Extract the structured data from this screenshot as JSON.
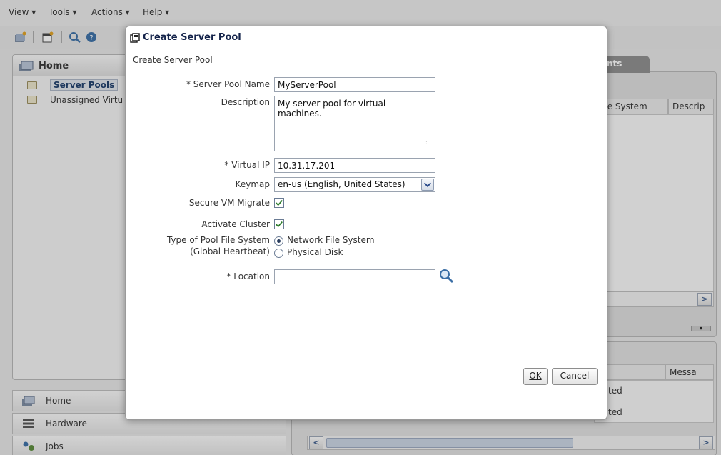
{
  "menubar": {
    "items": [
      {
        "label": "View",
        "accel": "V"
      },
      {
        "label": "Tools",
        "accel": "T"
      },
      {
        "label": "Actions",
        "accel": "A"
      },
      {
        "label": "Help",
        "accel": "H"
      }
    ]
  },
  "navigator": {
    "header": "Home",
    "items": [
      {
        "label": "Server Pools",
        "selected": true
      },
      {
        "label": "Unassigned Virtu",
        "selected": false
      }
    ]
  },
  "accordion": {
    "items": [
      {
        "label": "Home",
        "icon": "home-icon"
      },
      {
        "label": "Hardware",
        "icon": "hardware-icon"
      },
      {
        "label": "Jobs",
        "icon": "jobs-icon"
      }
    ]
  },
  "right_panel": {
    "tab_label": "nts",
    "columns": [
      "File System",
      "Descrip"
    ]
  },
  "jobs_panel": {
    "columns": [
      "Messa"
    ],
    "rows": [
      "ted",
      "ted"
    ]
  },
  "dialog": {
    "title": "Create Server Pool",
    "subtitle": "Create Server Pool",
    "fields": {
      "name": {
        "label": "Server Pool Name",
        "required": true,
        "value": "MyServerPool"
      },
      "description": {
        "label": "Description",
        "value": "My server pool for virtual\nmachines."
      },
      "virtual_ip": {
        "label": "Virtual IP",
        "required": true,
        "value": "10.31.17.201"
      },
      "keymap": {
        "label": "Keymap",
        "value": "en-us (English, United States)"
      },
      "secure_vm_migrate": {
        "label": "Secure VM Migrate",
        "checked": true
      },
      "activate_cluster": {
        "label": "Activate Cluster",
        "checked": true
      },
      "pool_fs_type": {
        "label_line1": "Type of Pool File System",
        "label_line2": "(Global Heartbeat)",
        "options": [
          {
            "label": "Network File System",
            "selected": true
          },
          {
            "label": "Physical Disk",
            "selected": false
          }
        ]
      },
      "location": {
        "label": "Location",
        "required": true,
        "value": ""
      }
    },
    "buttons": {
      "ok": {
        "label": "OK",
        "accel": "O"
      },
      "cancel": {
        "label": "Cancel",
        "accel": "C"
      }
    },
    "required_marker": "*"
  },
  "colors": {
    "title_text": "#14234a",
    "check_mark": "#2a7a2a",
    "search_icon": "#3a6ea5"
  }
}
